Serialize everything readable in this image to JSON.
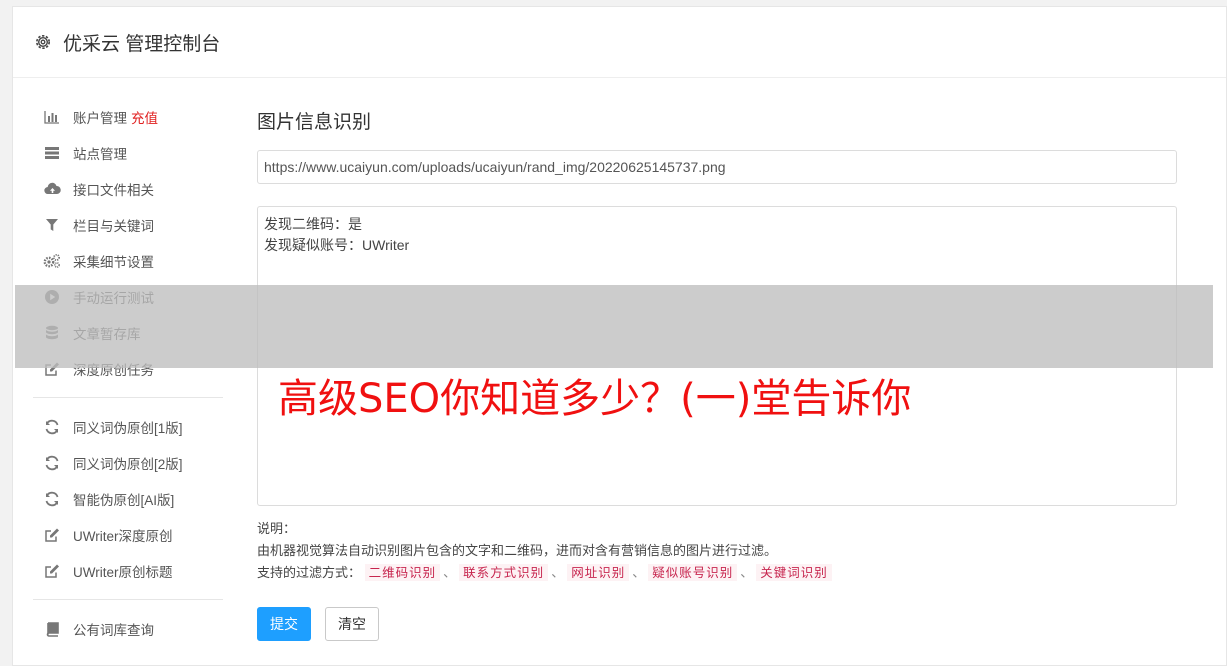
{
  "header": {
    "title": "优采云 管理控制台",
    "icon": "gear-icon"
  },
  "sidebar": {
    "group1": [
      {
        "label": "账户管理",
        "icon": "bar-chart-icon",
        "extra": "充值"
      },
      {
        "label": "站点管理",
        "icon": "server-icon"
      },
      {
        "label": "接口文件相关",
        "icon": "cloud-upload-icon"
      },
      {
        "label": "栏目与关键词",
        "icon": "filter-icon"
      },
      {
        "label": "采集细节设置",
        "icon": "gears-icon"
      },
      {
        "label": "手动运行测试",
        "icon": "play-circle-icon"
      },
      {
        "label": "文章暂存库",
        "icon": "database-icon"
      },
      {
        "label": "深度原创任务",
        "icon": "edit-icon"
      }
    ],
    "group2": [
      {
        "label": "同义词伪原创[1版]",
        "icon": "refresh-icon"
      },
      {
        "label": "同义词伪原创[2版]",
        "icon": "refresh-icon"
      },
      {
        "label": "智能伪原创[AI版]",
        "icon": "refresh-icon"
      },
      {
        "label": "UWriter深度原创",
        "icon": "edit-icon"
      },
      {
        "label": "UWriter原创标题",
        "icon": "edit-icon"
      }
    ],
    "group3": [
      {
        "label": "公有词库查询",
        "icon": "book-icon"
      }
    ]
  },
  "main": {
    "title": "图片信息识别",
    "url_value": "https://www.ucaiyun.com/uploads/ucaiyun/rand_img/20220625145737.png",
    "result_lines": [
      "发现二维码：是",
      "发现疑似账号：UWriter"
    ],
    "notes": {
      "heading": "说明：",
      "description": "由机器视觉算法自动识别图片包含的文字和二维码，进而对含有营销信息的图片进行过滤。",
      "filters_label": "支持的过滤方式：",
      "filters": [
        "二维码识别",
        "联系方式识别",
        "网址识别",
        "疑似账号识别",
        "关键词识别"
      ],
      "separator": "、"
    },
    "submit_label": "提交",
    "clear_label": "清空"
  },
  "overlay": {
    "text": "高级SEO你知道多少？(一)堂告诉你"
  },
  "colors": {
    "primary": "#1e9fff",
    "recharge": "#e02020",
    "overlay_text": "#f01010"
  }
}
